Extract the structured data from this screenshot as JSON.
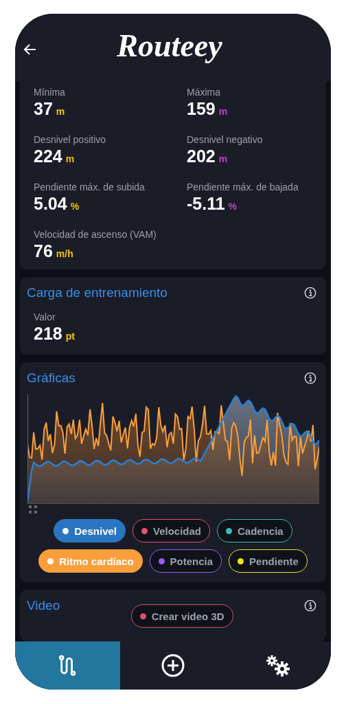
{
  "header": {
    "title": "Routeey"
  },
  "stats": [
    {
      "label": "Mínima",
      "value": "37",
      "unit": "m",
      "color": "#f2c200"
    },
    {
      "label": "Máxima",
      "value": "159",
      "unit": "m",
      "color": "#c23fc0"
    },
    {
      "label": "Desnivel positivo",
      "value": "224",
      "unit": "m",
      "color": "#f2c200"
    },
    {
      "label": "Desnivel negativo",
      "value": "202",
      "unit": "m",
      "color": "#c23fc0"
    },
    {
      "label": "Pendiente máx. de subida",
      "value": "5.04",
      "unit": "%",
      "color": "#f2c200"
    },
    {
      "label": "Pendiente máx. de bajada",
      "value": "-5.11",
      "unit": "%",
      "color": "#c23fc0"
    },
    {
      "label": "Velocidad de ascenso (VAM)",
      "value": "76",
      "unit": "m/h",
      "color": "#f2c200"
    }
  ],
  "training_load": {
    "title": "Carga de entrenamiento",
    "label": "Valor",
    "value": "218",
    "unit": "pt",
    "color": "#f2c200"
  },
  "charts": {
    "title": "Gráficas",
    "series_toggles": [
      {
        "label": "Desnivel",
        "color": "#2a75c2",
        "selected": true
      },
      {
        "label": "Velocidad",
        "color": "#e8516e",
        "selected": false
      },
      {
        "label": "Cadencia",
        "color": "#3cbcb0",
        "selected": false
      },
      {
        "label": "Ritmo cardíaco",
        "color": "#fb9e3c",
        "selected": true
      },
      {
        "label": "Potencia",
        "color": "#9a5cf2",
        "selected": false
      },
      {
        "label": "Pendiente",
        "color": "#f2e41a",
        "selected": false
      }
    ]
  },
  "video": {
    "title": "Video",
    "button": {
      "label": "Crear video 3D",
      "color": "#d9506a"
    }
  },
  "nav": [
    {
      "kind": "route",
      "selected": true
    },
    {
      "kind": "add",
      "selected": false
    },
    {
      "kind": "settings",
      "selected": false
    }
  ]
}
